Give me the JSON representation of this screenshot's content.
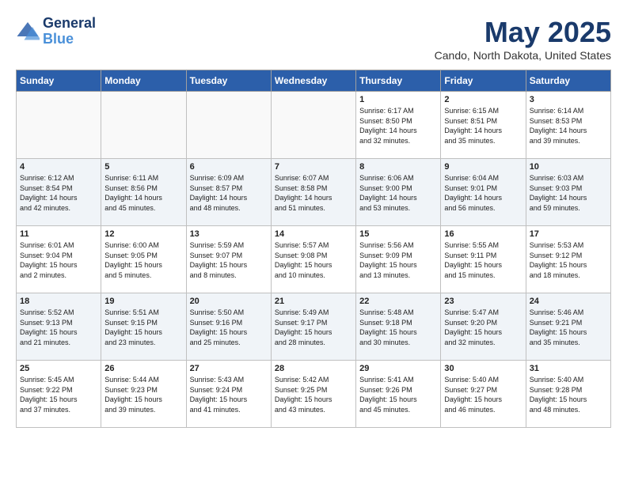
{
  "header": {
    "logo_line1": "General",
    "logo_line2": "Blue",
    "month": "May 2025",
    "location": "Cando, North Dakota, United States"
  },
  "weekdays": [
    "Sunday",
    "Monday",
    "Tuesday",
    "Wednesday",
    "Thursday",
    "Friday",
    "Saturday"
  ],
  "weeks": [
    [
      {
        "day": "",
        "content": ""
      },
      {
        "day": "",
        "content": ""
      },
      {
        "day": "",
        "content": ""
      },
      {
        "day": "",
        "content": ""
      },
      {
        "day": "1",
        "content": "Sunrise: 6:17 AM\nSunset: 8:50 PM\nDaylight: 14 hours\nand 32 minutes."
      },
      {
        "day": "2",
        "content": "Sunrise: 6:15 AM\nSunset: 8:51 PM\nDaylight: 14 hours\nand 35 minutes."
      },
      {
        "day": "3",
        "content": "Sunrise: 6:14 AM\nSunset: 8:53 PM\nDaylight: 14 hours\nand 39 minutes."
      }
    ],
    [
      {
        "day": "4",
        "content": "Sunrise: 6:12 AM\nSunset: 8:54 PM\nDaylight: 14 hours\nand 42 minutes."
      },
      {
        "day": "5",
        "content": "Sunrise: 6:11 AM\nSunset: 8:56 PM\nDaylight: 14 hours\nand 45 minutes."
      },
      {
        "day": "6",
        "content": "Sunrise: 6:09 AM\nSunset: 8:57 PM\nDaylight: 14 hours\nand 48 minutes."
      },
      {
        "day": "7",
        "content": "Sunrise: 6:07 AM\nSunset: 8:58 PM\nDaylight: 14 hours\nand 51 minutes."
      },
      {
        "day": "8",
        "content": "Sunrise: 6:06 AM\nSunset: 9:00 PM\nDaylight: 14 hours\nand 53 minutes."
      },
      {
        "day": "9",
        "content": "Sunrise: 6:04 AM\nSunset: 9:01 PM\nDaylight: 14 hours\nand 56 minutes."
      },
      {
        "day": "10",
        "content": "Sunrise: 6:03 AM\nSunset: 9:03 PM\nDaylight: 14 hours\nand 59 minutes."
      }
    ],
    [
      {
        "day": "11",
        "content": "Sunrise: 6:01 AM\nSunset: 9:04 PM\nDaylight: 15 hours\nand 2 minutes."
      },
      {
        "day": "12",
        "content": "Sunrise: 6:00 AM\nSunset: 9:05 PM\nDaylight: 15 hours\nand 5 minutes."
      },
      {
        "day": "13",
        "content": "Sunrise: 5:59 AM\nSunset: 9:07 PM\nDaylight: 15 hours\nand 8 minutes."
      },
      {
        "day": "14",
        "content": "Sunrise: 5:57 AM\nSunset: 9:08 PM\nDaylight: 15 hours\nand 10 minutes."
      },
      {
        "day": "15",
        "content": "Sunrise: 5:56 AM\nSunset: 9:09 PM\nDaylight: 15 hours\nand 13 minutes."
      },
      {
        "day": "16",
        "content": "Sunrise: 5:55 AM\nSunset: 9:11 PM\nDaylight: 15 hours\nand 15 minutes."
      },
      {
        "day": "17",
        "content": "Sunrise: 5:53 AM\nSunset: 9:12 PM\nDaylight: 15 hours\nand 18 minutes."
      }
    ],
    [
      {
        "day": "18",
        "content": "Sunrise: 5:52 AM\nSunset: 9:13 PM\nDaylight: 15 hours\nand 21 minutes."
      },
      {
        "day": "19",
        "content": "Sunrise: 5:51 AM\nSunset: 9:15 PM\nDaylight: 15 hours\nand 23 minutes."
      },
      {
        "day": "20",
        "content": "Sunrise: 5:50 AM\nSunset: 9:16 PM\nDaylight: 15 hours\nand 25 minutes."
      },
      {
        "day": "21",
        "content": "Sunrise: 5:49 AM\nSunset: 9:17 PM\nDaylight: 15 hours\nand 28 minutes."
      },
      {
        "day": "22",
        "content": "Sunrise: 5:48 AM\nSunset: 9:18 PM\nDaylight: 15 hours\nand 30 minutes."
      },
      {
        "day": "23",
        "content": "Sunrise: 5:47 AM\nSunset: 9:20 PM\nDaylight: 15 hours\nand 32 minutes."
      },
      {
        "day": "24",
        "content": "Sunrise: 5:46 AM\nSunset: 9:21 PM\nDaylight: 15 hours\nand 35 minutes."
      }
    ],
    [
      {
        "day": "25",
        "content": "Sunrise: 5:45 AM\nSunset: 9:22 PM\nDaylight: 15 hours\nand 37 minutes."
      },
      {
        "day": "26",
        "content": "Sunrise: 5:44 AM\nSunset: 9:23 PM\nDaylight: 15 hours\nand 39 minutes."
      },
      {
        "day": "27",
        "content": "Sunrise: 5:43 AM\nSunset: 9:24 PM\nDaylight: 15 hours\nand 41 minutes."
      },
      {
        "day": "28",
        "content": "Sunrise: 5:42 AM\nSunset: 9:25 PM\nDaylight: 15 hours\nand 43 minutes."
      },
      {
        "day": "29",
        "content": "Sunrise: 5:41 AM\nSunset: 9:26 PM\nDaylight: 15 hours\nand 45 minutes."
      },
      {
        "day": "30",
        "content": "Sunrise: 5:40 AM\nSunset: 9:27 PM\nDaylight: 15 hours\nand 46 minutes."
      },
      {
        "day": "31",
        "content": "Sunrise: 5:40 AM\nSunset: 9:28 PM\nDaylight: 15 hours\nand 48 minutes."
      }
    ]
  ]
}
